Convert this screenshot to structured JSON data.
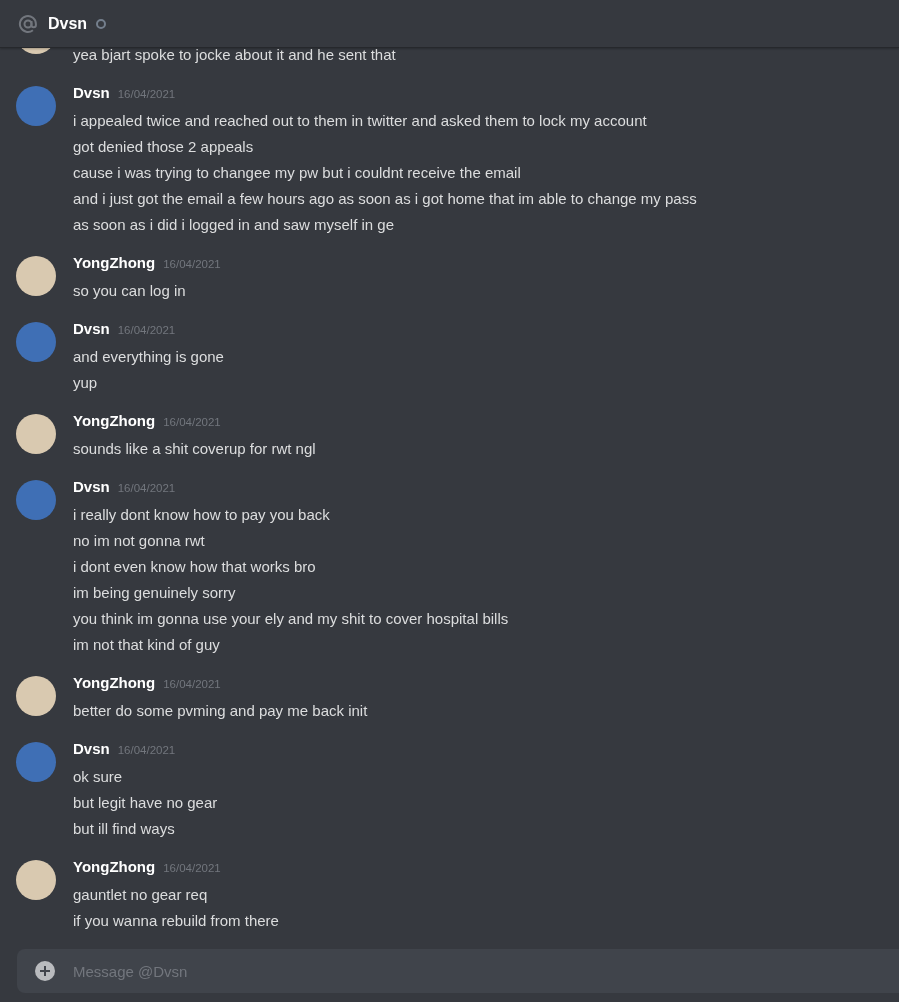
{
  "header": {
    "title": "Dvsn",
    "online": false
  },
  "messages": [
    {
      "color": "#d9c9b0",
      "lines": [
        "yea bjart spoke to jocke about it and he sent that"
      ]
    },
    {
      "author": "Dvsn",
      "time": "16/04/2021",
      "color": "#3f6fb5",
      "lines": [
        "i appealed twice and reached out to them in twitter and asked them to lock my account",
        "got denied those 2 appeals",
        "cause i was trying to changee my pw but i couldnt receive the email",
        "and i just got the email a few hours ago as soon as i got home that im able to change my pass",
        "as soon as i did i logged in and saw myself in ge"
      ]
    },
    {
      "author": "YongZhong",
      "time": "16/04/2021",
      "color": "#d9c9b0",
      "lines": [
        "so you can log in"
      ]
    },
    {
      "author": "Dvsn",
      "time": "16/04/2021",
      "color": "#3f6fb5",
      "lines": [
        "and everything is gone",
        "yup"
      ]
    },
    {
      "author": "YongZhong",
      "time": "16/04/2021",
      "color": "#d9c9b0",
      "lines": [
        "sounds like a shit coverup for rwt ngl"
      ]
    },
    {
      "author": "Dvsn",
      "time": "16/04/2021",
      "color": "#3f6fb5",
      "lines": [
        "i really dont know how to pay you back",
        "no im not gonna rwt",
        "i dont even know how that works bro",
        "im being genuinely sorry",
        "you think im gonna use your ely and my shit to cover hospital bills",
        "im not that kind of guy"
      ]
    },
    {
      "author": "YongZhong",
      "time": "16/04/2021",
      "color": "#d9c9b0",
      "lines": [
        "better do some pvming and pay me back init"
      ]
    },
    {
      "author": "Dvsn",
      "time": "16/04/2021",
      "color": "#3f6fb5",
      "lines": [
        "ok sure",
        "but legit have no gear",
        "but ill find ways"
      ]
    },
    {
      "author": "YongZhong",
      "time": "16/04/2021",
      "color": "#d9c9b0",
      "lines": [
        "gauntlet no gear req",
        "if you wanna rebuild from there"
      ]
    }
  ],
  "composer": {
    "placeholder": "Message @Dvsn"
  }
}
